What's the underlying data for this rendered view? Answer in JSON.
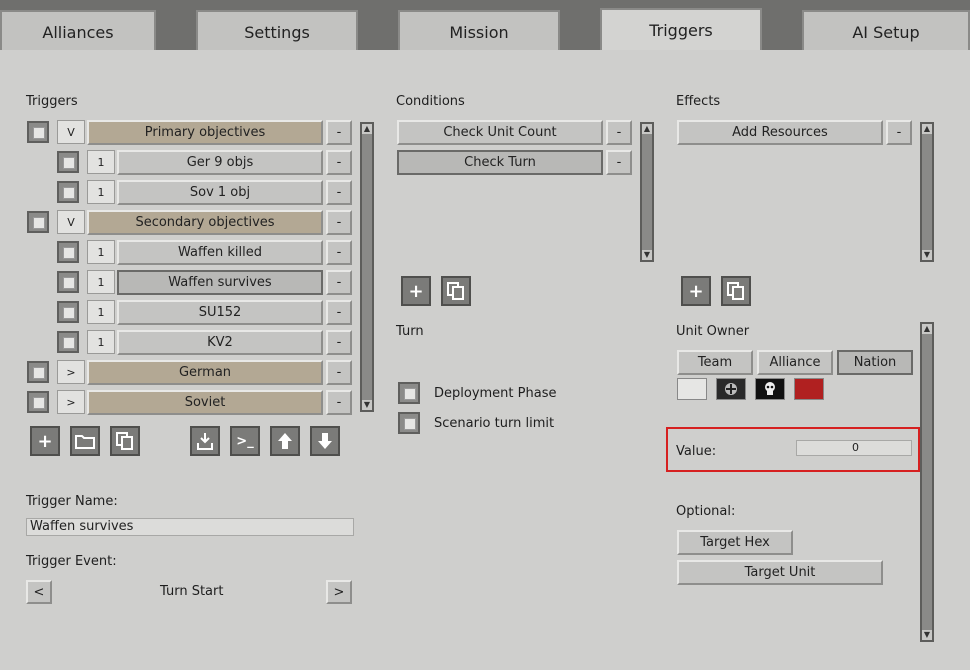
{
  "tabs": [
    "Alliances",
    "Settings",
    "Mission",
    "Triggers",
    "AI Setup"
  ],
  "active_tab": "Triggers",
  "triggers": {
    "heading": "Triggers",
    "rows": [
      {
        "toggle": "V",
        "label": "Primary objectives",
        "indent": false,
        "remove": "-"
      },
      {
        "toggle": "1",
        "label": "Ger 9 objs",
        "indent": true,
        "remove": "-"
      },
      {
        "toggle": "1",
        "label": "Sov 1 obj",
        "indent": true,
        "remove": "-"
      },
      {
        "toggle": "V",
        "label": "Secondary objectives",
        "indent": false,
        "remove": "-"
      },
      {
        "toggle": "1",
        "label": "Waffen killed",
        "indent": true,
        "remove": "-"
      },
      {
        "toggle": "1",
        "label": "Waffen survives",
        "indent": true,
        "remove": "-"
      },
      {
        "toggle": "1",
        "label": "SU152",
        "indent": true,
        "remove": "-"
      },
      {
        "toggle": "1",
        "label": "KV2",
        "indent": true,
        "remove": "-"
      },
      {
        "toggle": ">",
        "label": "German",
        "indent": false,
        "remove": "-"
      },
      {
        "toggle": ">",
        "label": "Soviet",
        "indent": false,
        "remove": "-"
      }
    ],
    "name_label": "Trigger Name:",
    "name_value": "Waffen survives",
    "event_label": "Trigger Event:",
    "event_value": "Turn Start",
    "event_prev": "<",
    "event_next": ">"
  },
  "conditions": {
    "heading": "Conditions",
    "items": [
      "Check Unit Count",
      "Check Turn"
    ],
    "remove": "-",
    "turn_heading": "Turn",
    "options": [
      "Deployment Phase",
      "Scenario turn limit"
    ]
  },
  "effects": {
    "heading": "Effects",
    "items": [
      "Add Resources"
    ],
    "remove": "-",
    "owner_heading": "Unit Owner",
    "owner_buttons": [
      "Team",
      "Alliance",
      "Nation"
    ],
    "value_label": "Value:",
    "value": "0",
    "optional_heading": "Optional:",
    "target_hex": "Target Hex",
    "target_unit": "Target Unit"
  },
  "icons": {
    "add": "+",
    "folder": "folder-icon",
    "copy": "copy-icon",
    "import": "import-icon",
    "console": ">_",
    "up": "up-arrow-icon",
    "down": "down-arrow-icon"
  },
  "flag_colors": [
    "#e6e6e4",
    "#2a2a2a",
    "#111111",
    "#b02020"
  ]
}
